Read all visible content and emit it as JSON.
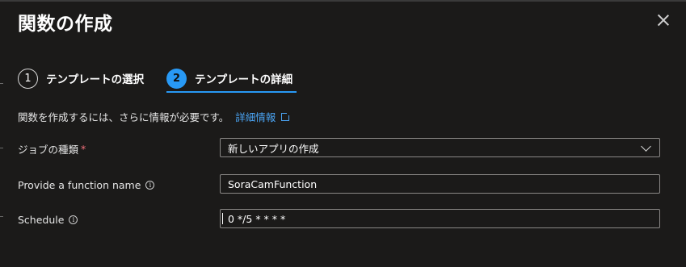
{
  "dialog": {
    "title": "関数の作成",
    "close_label": "×"
  },
  "steps": [
    {
      "number": "1",
      "label": "テンプレートの選択",
      "state": "completed"
    },
    {
      "number": "2",
      "label": "テンプレートの詳細",
      "state": "active"
    }
  ],
  "description": {
    "text": "関数を作成するには、さらに情報が必要です。",
    "link": "詳細情報"
  },
  "form": {
    "job_type": {
      "label": "ジョブの種類",
      "required_mark": "*",
      "value": "新しいアプリの作成"
    },
    "function_name": {
      "label": "Provide a function name",
      "value": "SoraCamFunction"
    },
    "schedule": {
      "label": "Schedule",
      "value": "0 */5 * * * *"
    }
  },
  "colors": {
    "background": "#1b1a19",
    "accent": "#2899f5",
    "link": "#4aa3f2",
    "required": "#f1707b"
  }
}
